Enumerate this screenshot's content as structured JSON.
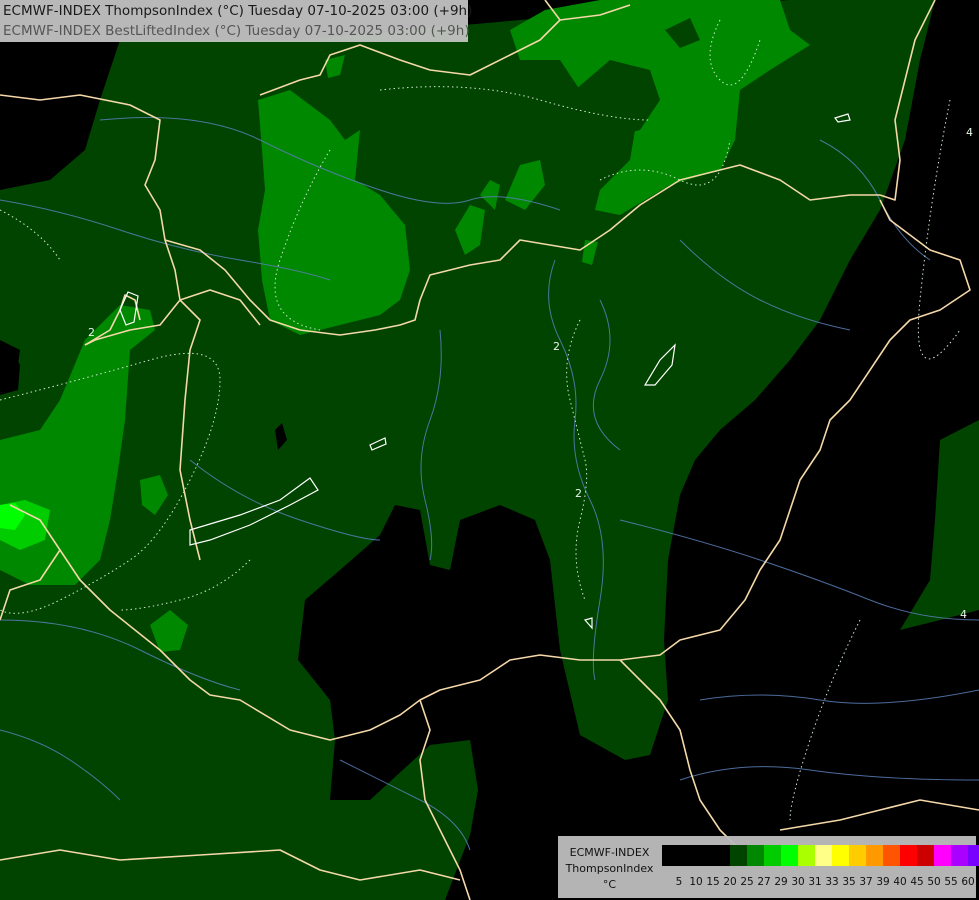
{
  "title": {
    "line1": "ECMWF-INDEX ThompsonIndex (°C) Tuesday 07-10-2025 03:00 (+9h)",
    "line2": "ECMWF-INDEX BestLiftedIndex (°C) Tuesday 07-10-2025 03:00 (+9h)"
  },
  "legend": {
    "model": "ECMWF-INDEX",
    "parameter": "ThompsonIndex",
    "unit": "°C",
    "ticks": [
      "5",
      "10",
      "15",
      "20",
      "25",
      "27",
      "29",
      "30",
      "31",
      "33",
      "35",
      "37",
      "39",
      "40",
      "45",
      "50",
      "55",
      "60"
    ],
    "colors": [
      "#000000",
      "#000000",
      "#000000",
      "#000000",
      "#004400",
      "#008800",
      "#00cc00",
      "#00ff00",
      "#aaff00",
      "#ffff88",
      "#ffff00",
      "#ffcc00",
      "#ff9900",
      "#ff5500",
      "#ff0000",
      "#cc0000",
      "#ff00ff",
      "#aa00ff",
      "#7700ff",
      "#0000ff"
    ]
  },
  "contour_labels": [
    "2",
    "2",
    "2",
    "4",
    "4"
  ],
  "colors": {
    "dark_green": "#004400",
    "mid_green": "#008800",
    "bright_green": "#00cc00",
    "lime": "#00ff00",
    "border": "#f5d8a8",
    "river": "#5a7fb8"
  }
}
